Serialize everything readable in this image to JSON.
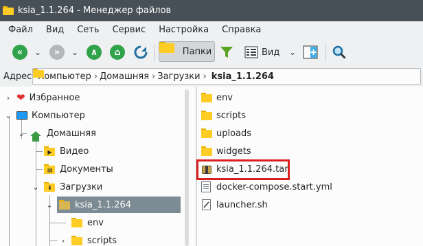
{
  "window": {
    "title": "ksia_1.1.264 - Менеджер файлов"
  },
  "menubar": {
    "items": [
      "Файл",
      "Вид",
      "Сеть",
      "Сервис",
      "Настройка",
      "Справка"
    ]
  },
  "toolbar": {
    "folders_label": "Папки",
    "view_label": "Вид"
  },
  "address": {
    "label": "Адрес:",
    "crumbs": [
      "Компьютер",
      "Домашняя",
      "Загрузки"
    ],
    "current": "ksia_1.1.264",
    "separator": "›"
  },
  "tree": {
    "favorites": "Избранное",
    "computer": "Компьютер",
    "home": "Домашняя",
    "video": "Видео",
    "documents": "Документы",
    "downloads": "Загрузки",
    "ksia": "ksia_1.1.264",
    "env": "env",
    "scripts": "scripts"
  },
  "files": [
    {
      "name": "env",
      "type": "folder"
    },
    {
      "name": "scripts",
      "type": "folder"
    },
    {
      "name": "uploads",
      "type": "folder"
    },
    {
      "name": "widgets",
      "type": "folder"
    },
    {
      "name": "ksia_1.1.264.tar",
      "type": "archive",
      "highlighted": true
    },
    {
      "name": "docker-compose.start.yml",
      "type": "text"
    },
    {
      "name": "launcher.sh",
      "type": "script"
    }
  ],
  "colors": {
    "titlebar": "#475057",
    "selection": "#7d8b94",
    "highlight_box": "#d81e1e",
    "nav_green": "#2fa24a"
  }
}
